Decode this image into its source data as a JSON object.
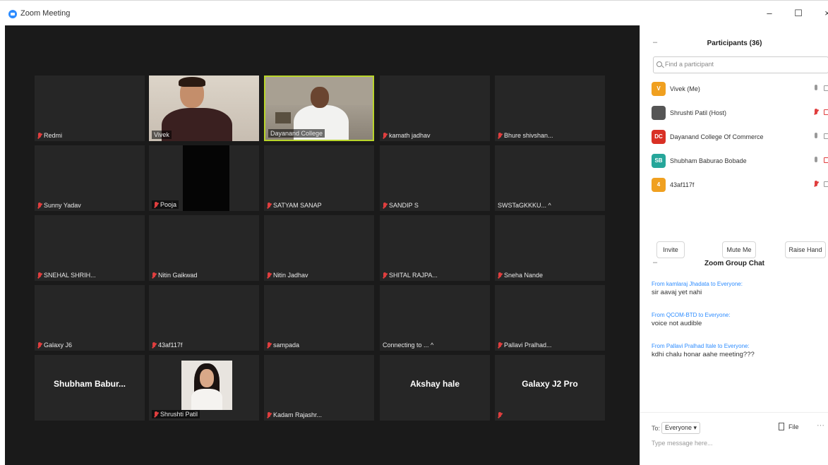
{
  "window": {
    "title": "Zoom Meeting",
    "min": "–",
    "max": "☐",
    "close": "×"
  },
  "grid": [
    [
      {
        "name": "Redmi",
        "muted": true
      },
      {
        "name": "Vivek",
        "muted": false,
        "video": "vivek"
      },
      {
        "name": "Dayanand College",
        "muted": false,
        "video": "dayanand",
        "active": true
      },
      {
        "name": "kamath jadhav",
        "muted": true
      },
      {
        "name": "Bhure shivshan...",
        "muted": true
      }
    ],
    [
      {
        "name": "Sunny Yadav",
        "muted": true
      },
      {
        "name": "Pooja",
        "muted": true,
        "video": "pooja"
      },
      {
        "name": "SATYAM SANAP",
        "muted": true
      },
      {
        "name": "SANDIP S",
        "muted": true
      },
      {
        "name": "SWSTaGKKKU... ^",
        "muted": false
      }
    ],
    [
      {
        "name": "SNEHAL SHRIH...",
        "muted": true
      },
      {
        "name": "Nitin Gaikwad",
        "muted": true
      },
      {
        "name": "Nitin Jadhav",
        "muted": true
      },
      {
        "name": "SHITAL RAJPA...",
        "muted": true
      },
      {
        "name": "Sneha Nande",
        "muted": true
      }
    ],
    [
      {
        "name": "Galaxy J6",
        "muted": true
      },
      {
        "name": "43af117f",
        "muted": true
      },
      {
        "name": "sampada",
        "muted": true
      },
      {
        "name": "Connecting to ... ^",
        "muted": false
      },
      {
        "name": "Pallavi Pralhad...",
        "muted": true
      }
    ],
    [
      {
        "name": "",
        "muted": false,
        "big": "Shubham Babur..."
      },
      {
        "name": "Shrushti Patil",
        "muted": true,
        "video": "shrushti"
      },
      {
        "name": "Kadam Rajashr...",
        "muted": true
      },
      {
        "name": "",
        "muted": false,
        "big": "Akshay hale"
      },
      {
        "name": "",
        "muted": true,
        "big": "Galaxy J2 Pro"
      }
    ]
  ],
  "participants": {
    "title": "Participants (36)",
    "collapse": "–",
    "search_placeholder": "Find a participant",
    "list": [
      {
        "initials": "V",
        "color": "#f0a020",
        "name": "Vivek (Me)",
        "muted": false,
        "camoff": false
      },
      {
        "initials": "",
        "color": "#555555",
        "name": "Shrushti Patil (Host)",
        "muted": true,
        "camoff": true
      },
      {
        "initials": "DC",
        "color": "#d93025",
        "name": "Dayanand College Of Commerce",
        "muted": false,
        "camoff": false
      },
      {
        "initials": "SB",
        "color": "#26a69a",
        "name": "Shubham Baburao Bobade",
        "muted": false,
        "camoff": true
      },
      {
        "initials": "4",
        "color": "#f0a020",
        "name": "43af117f",
        "muted": true,
        "camoff": false
      }
    ],
    "invite": "Invite",
    "mute_me": "Mute Me",
    "raise_hand": "Raise Hand"
  },
  "chat": {
    "title": "Zoom Group Chat",
    "collapse": "–",
    "messages": [
      {
        "from": "From kamlaraj Jhadata to Everyone:",
        "text": "sir aavaj yet nahi"
      },
      {
        "from": "From QCOM-BTD to Everyone:",
        "text": "voice not audible"
      },
      {
        "from": "From Pallavi Pralhad Itale to Everyone:",
        "text": "kdhi chalu honar aahe meeting???"
      }
    ],
    "to_label": "To:",
    "recipient": "Everyone ▾",
    "file": "File",
    "more": "···",
    "input_placeholder": "Type message here..."
  }
}
